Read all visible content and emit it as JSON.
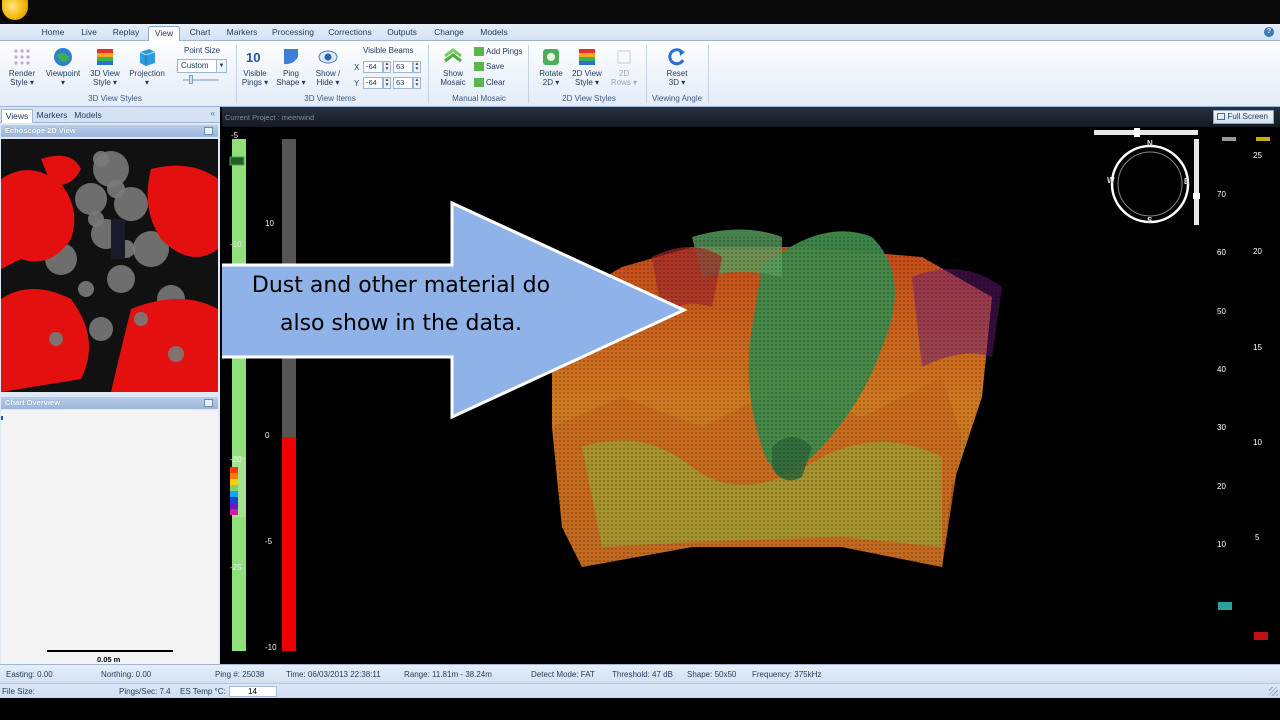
{
  "tabs": [
    {
      "label": "Home",
      "active": false
    },
    {
      "label": "Live",
      "active": false
    },
    {
      "label": "Replay",
      "active": false
    },
    {
      "label": "View",
      "active": true
    },
    {
      "label": "Chart",
      "active": false
    },
    {
      "label": "Markers",
      "active": false
    },
    {
      "label": "Processing",
      "active": false
    },
    {
      "label": "Corrections",
      "active": false
    },
    {
      "label": "Outputs",
      "active": false
    },
    {
      "label": "Change",
      "active": false
    },
    {
      "label": "Models",
      "active": false
    }
  ],
  "ribbon": {
    "render_style": [
      "Render",
      "Style ▾"
    ],
    "viewpoint": [
      "Viewpoint",
      "▾"
    ],
    "view_3d_style": [
      "3D View",
      "Style ▾"
    ],
    "projection": [
      "Projection",
      "▾"
    ],
    "point_size_label": "Point Size",
    "point_size_value": "Custom",
    "group_3d_view_styles": "3D View Styles",
    "visible_pings": [
      "Visible",
      "Pings ▾"
    ],
    "ping_shape": [
      "Ping",
      "Shape ▾"
    ],
    "show_hide": [
      "Show /",
      "Hide ▾"
    ],
    "visible_beams_label": "Visible Beams",
    "x_label": "X",
    "y_label": "Y",
    "beam_x_from": "-64",
    "beam_x_to": "63",
    "beam_y_from": "-64",
    "beam_y_to": "63",
    "group_3d_view_items": "3D View Items",
    "show_mosaic": [
      "Show",
      "Mosaic"
    ],
    "add_pings": "Add Pings",
    "save": "Save",
    "clear": "Clear",
    "group_manual_mosaic": "Manual Mosaic",
    "rotate_2d": [
      "Rotate",
      "2D ▾"
    ],
    "view_2d_style": [
      "2D View",
      "Style ▾"
    ],
    "rows_2d": [
      "2D",
      "Rows ▾"
    ],
    "group_2d_view_styles": "2D View Styles",
    "reset_3d": [
      "Reset",
      "3D ▾"
    ],
    "group_viewing_angle": "Viewing Angle"
  },
  "left_panel": {
    "tabs": [
      "Views",
      "Markers",
      "Models"
    ],
    "echo_title": "Echoscope 2D View",
    "overview_title": "Chart Overview",
    "scale_label": "0.05 m"
  },
  "main": {
    "project_label": "Current Project : meerwind",
    "full_screen": "Full Screen",
    "callout_line1": "Dust and other material do",
    "callout_line2": "also show in the data.",
    "left_axis_ticks": [
      "-5",
      "-10",
      "-20",
      "-25"
    ],
    "green_bar_ticks": [
      "10"
    ],
    "red_bar_ticks": [
      "0",
      "-5",
      "-10"
    ],
    "compass": {
      "n": "N",
      "s": "S",
      "e": "E",
      "w": "W"
    },
    "ruler_inner": [
      "70",
      "60",
      "50",
      "40",
      "30",
      "20",
      "10"
    ],
    "ruler_outer": [
      "25",
      "20",
      "15",
      "10",
      "5"
    ]
  },
  "status": {
    "easting": "Easting: 0.00",
    "northing": "Northing: 0.00",
    "ping": "Ping #: 25038",
    "time": "Time: 06/03/2013 22:38:11",
    "range": "Range: 11.81m - 38.24m",
    "detect_mode": "Detect Mode: FAT",
    "threshold": "Threshold: 47 dB",
    "shape": "Shape: 50x50",
    "frequency": "Frequency: 375kHz",
    "file_size": "File Size:",
    "pings_sec": "Pings/Sec: 7.4",
    "es_temp_label": "ES Temp °C:",
    "es_temp_value": "14"
  },
  "colors": {
    "accent": "#1e395b",
    "ribbon_bg": "#e3ecf8",
    "callout_fill": "#8fb3e8",
    "depth_bar_green": "#8fe07a",
    "depth_bar_red": "#ee0000"
  }
}
